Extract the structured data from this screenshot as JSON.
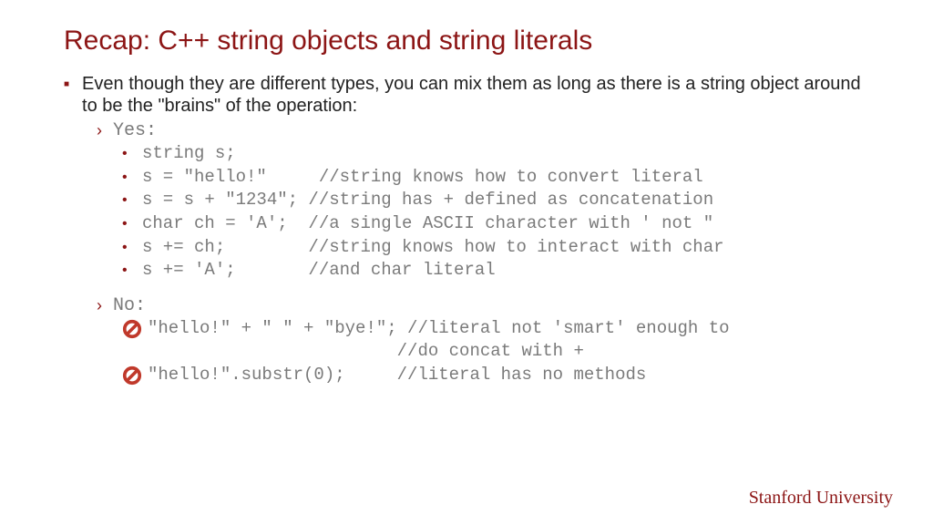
{
  "title": "Recap: C++ string objects and string literals",
  "intro": "Even though they are different types, you can mix them as long as there is a string object around to be the \"brains\" of the operation:",
  "yes": {
    "label": "Yes:",
    "lines": [
      "string s;",
      "s = \"hello!\"     //string knows how to convert literal",
      "s = s + \"1234\"; //string has + defined as concatenation",
      "char ch = 'A';  //a single ASCII character with ' not \"",
      "s += ch;        //string knows how to interact with char",
      "s += 'A';       //and char literal"
    ]
  },
  "no": {
    "label": "No:",
    "lines": [
      "\"hello!\" + \" \" + \"bye!\"; //literal not 'smart' enough to",
      "                        //do concat with +",
      "\"hello!\".substr(0);     //literal has no methods"
    ]
  },
  "footer": "Stanford University"
}
